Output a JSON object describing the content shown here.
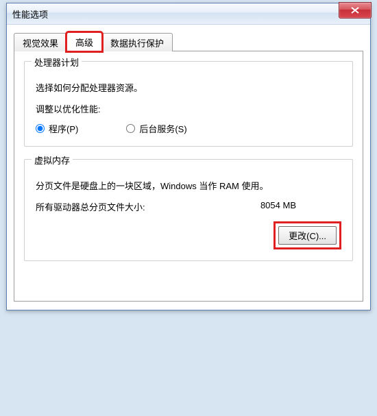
{
  "window": {
    "title": "性能选项"
  },
  "tabs": {
    "visual": "视觉效果",
    "advanced": "高级",
    "dep": "数据执行保护"
  },
  "processor": {
    "legend": "处理器计划",
    "desc": "选择如何分配处理器资源。",
    "sublabel": "调整以优化性能:",
    "opt_programs": "程序(P)",
    "opt_background": "后台服务(S)"
  },
  "vmem": {
    "legend": "虚拟内存",
    "desc": "分页文件是硬盘上的一块区域，Windows 当作 RAM 使用。",
    "total_label": "所有驱动器总分页文件大小:",
    "total_value": "8054 MB",
    "change_btn": "更改(C)..."
  }
}
